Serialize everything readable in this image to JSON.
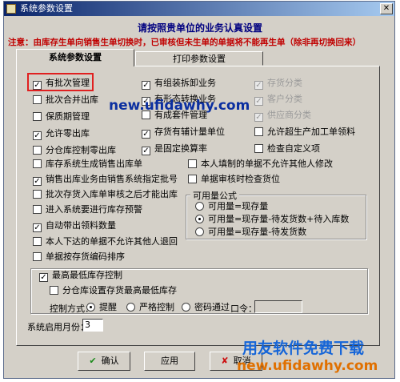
{
  "window": {
    "title": "系统参数设置",
    "close_glyph": "✕"
  },
  "heading": "请按照贵单位的业务认真设置",
  "notice": "注意：由库存生单向销售生单切换时，已审核但未生单的单据将不能再生单（除非再切换回来）",
  "tabs": [
    {
      "label": "系统参数设置",
      "active": true
    },
    {
      "label": "打印参数设置",
      "active": false
    }
  ],
  "options": {
    "batch_mgmt": {
      "label": "有批次管理",
      "checked": true
    },
    "batch_merge_out": {
      "label": "批次合并出库",
      "checked": false
    },
    "shelf_life": {
      "label": "保质期管理",
      "checked": false
    },
    "allow_zero_out": {
      "label": "允许零出库",
      "checked": true
    },
    "branch_zero_out": {
      "label": "分仓库控制零出库",
      "checked": false
    },
    "gen_sales_out": {
      "label": "库存系统生成销售出库单",
      "checked": false
    },
    "sales_out_batch": {
      "label": "销售出库业务由销售系统指定批号",
      "checked": true
    },
    "batch_after_audit": {
      "label": "批次存货入库单审核之后才能出库",
      "checked": false
    },
    "stock_warning": {
      "label": "进入系统要进行库存预警",
      "checked": false
    },
    "auto_qty": {
      "label": "自动带出领料数量",
      "checked": true
    },
    "no_modify_others": {
      "label": "本人下达的单据不允许其他人退回",
      "checked": false
    },
    "sort_by_code": {
      "label": "单据按存货编码排序",
      "checked": false
    },
    "assembly": {
      "label": "有组装拆卸业务",
      "checked": true
    },
    "form_convert": {
      "label": "有形态转换业务",
      "checked": true
    },
    "attachment": {
      "label": "有成套件管理",
      "checked": false
    },
    "aux_unit": {
      "label": "存货有辅计量单位",
      "checked": true
    },
    "fixed_rate": {
      "label": "是固定换算率",
      "checked": true
    },
    "inv_category": {
      "label": "存货分类",
      "checked": true,
      "disabled": true
    },
    "cust_category": {
      "label": "客户分类",
      "checked": true,
      "disabled": true
    },
    "vendor_category": {
      "label": "供应商分类",
      "checked": true,
      "disabled": true
    },
    "over_production": {
      "label": "允许超生产加工单领料",
      "checked": false
    },
    "custom_check": {
      "label": "检查自定义项",
      "checked": false
    },
    "no_modify_filled": {
      "label": "本人填制的单据不允许其他人修改",
      "checked": false
    },
    "check_location": {
      "label": "单据审核时检查货位",
      "checked": false
    },
    "min_stock_ctrl": {
      "label": "最高最低库存控制",
      "checked": true
    },
    "branch_min_stock": {
      "label": "分仓库设置存货最高最低库存",
      "checked": false
    }
  },
  "available": {
    "title": "可用量公式",
    "options": [
      {
        "label": "可用量=现存量",
        "selected": false
      },
      {
        "label": "可用量=现存量-待发货数+待入库数",
        "selected": true
      },
      {
        "label": "可用量=现存量-待发货数",
        "selected": false
      }
    ]
  },
  "control": {
    "label": "控制方式：",
    "options": [
      {
        "label": "提醒",
        "selected": true
      },
      {
        "label": "严格控制",
        "selected": false
      },
      {
        "label": "密码通过",
        "selected": false
      }
    ],
    "password_label": "口令：",
    "password_value": ""
  },
  "start_month": {
    "label": "系统启用月份：",
    "value": "3"
  },
  "buttons": {
    "ok": "确认",
    "ok_icon": "✔",
    "apply": "应用",
    "cancel": "取消",
    "cancel_icon": "✘"
  },
  "watermarks": {
    "site_center": "new.ufidawhy.com",
    "download": "用友软件免费下载",
    "site_bottom": "new.ufidawhy.com"
  }
}
